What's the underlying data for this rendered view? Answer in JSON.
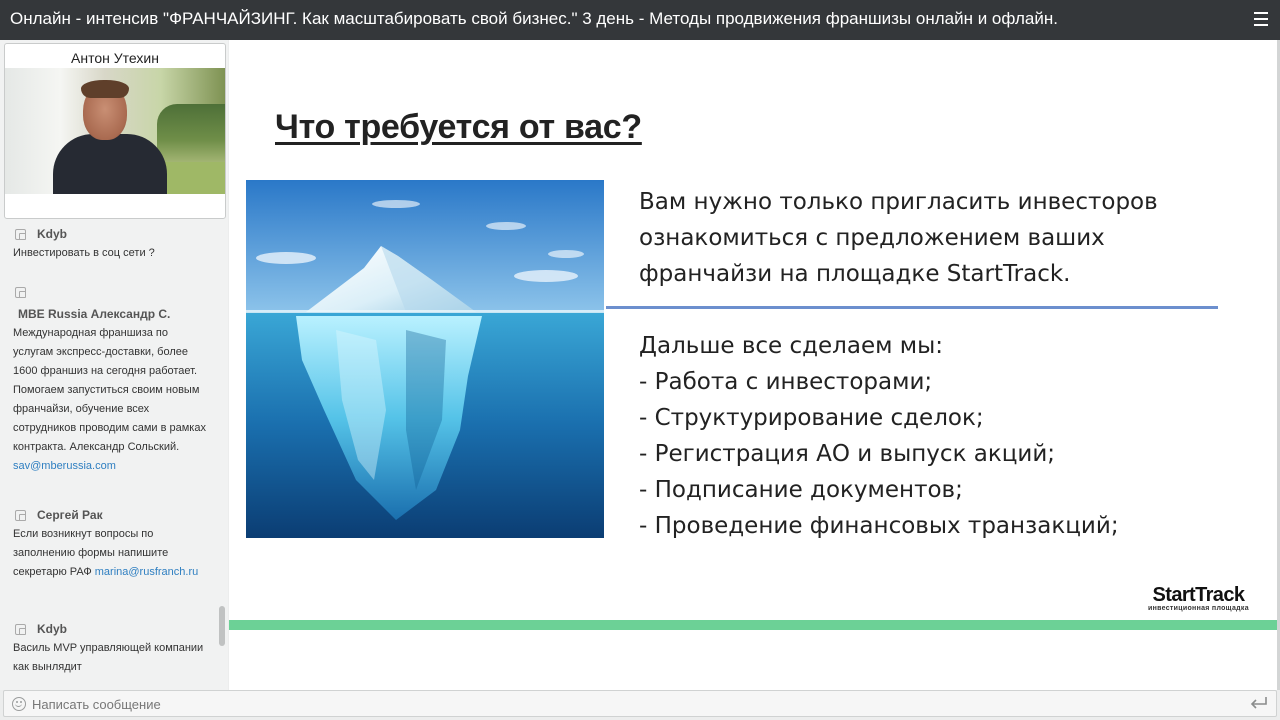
{
  "header": {
    "title": "Онлайн - интенсив \"ФРАНЧАЙЗИНГ. Как масштабировать свой бизнес.\" 3 день - Методы продвижения франшизы онлайн и офлайн.",
    "menu_icon": "hamburger-menu-icon"
  },
  "webcam": {
    "name": "Антон Утехин"
  },
  "chat": {
    "messages": [
      {
        "author": "Kdyb",
        "text": "Инвестировать в соц сети ?"
      },
      {
        "author": "МВЕ Russia Александр С.",
        "text": "Международная франшиза по услугам экспресс-доставки, более 1600 франшиз на сегодня работает. Помогаем запуститься своим новым франчайзи, обучение всех сотрудников проводим сами в рамках контракта. Александр Сольский.",
        "link": "sav@mberussia.com"
      },
      {
        "author": "Сергей Рак",
        "text": "Если возникнут вопросы по заполнению формы напишите секретарю РАФ",
        "link": "marina@rusfranch.ru"
      },
      {
        "author": "Kdyb",
        "text": "Василь MVP управляющей компании как вынлядит"
      }
    ]
  },
  "slide": {
    "title": "Что требуется от вас?",
    "paragraph1": [
      "Вам нужно только пригласить инвесторов",
      "ознакомиться с предложением ваших",
      "франчайзи на площадке StartTrack."
    ],
    "paragraph2": [
      "Дальше все сделаем мы:",
      "- Работа с инвесторами;",
      "- Структурирование сделок;",
      "- Регистрация АО и выпуск акций;",
      "- Подписание документов;",
      "- Проведение финансовых транзакций;"
    ],
    "logo_brand": "StartTrack",
    "logo_sub": "инвестиционная площадка",
    "accent_color": "#6cd196",
    "divider_color": "#6c8fce"
  },
  "input": {
    "placeholder": "Написать сообщение",
    "emoji_icon": "emoji-icon",
    "send_icon": "enter-send-icon"
  }
}
